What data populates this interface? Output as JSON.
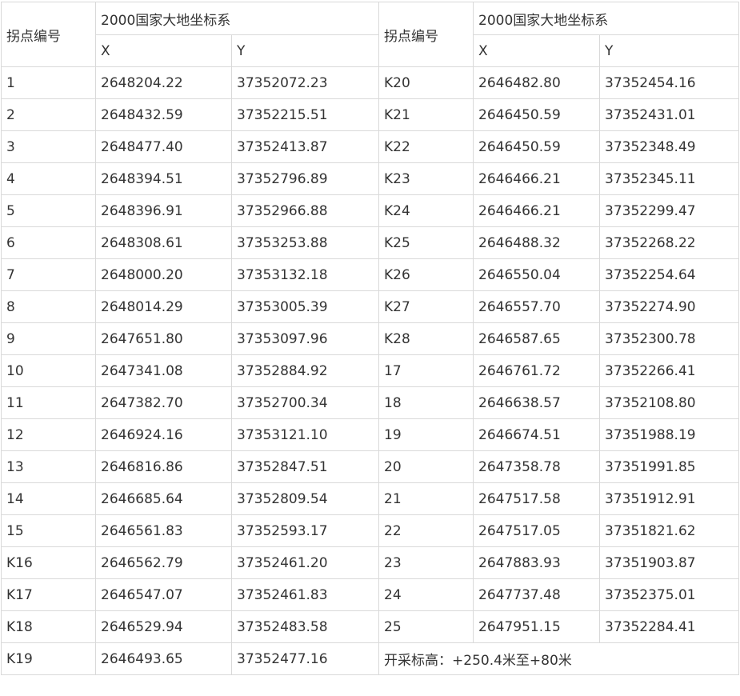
{
  "header": {
    "point_no_label": "拐点编号",
    "system_label": "2000国家大地坐标系",
    "x_label": "X",
    "y_label": "Y"
  },
  "rows": [
    {
      "left": {
        "id": "1",
        "x": "2648204.22",
        "y": "37352072.23"
      },
      "right": {
        "id": "K20",
        "x": "2646482.80",
        "y": "37352454.16"
      }
    },
    {
      "left": {
        "id": "2",
        "x": "2648432.59",
        "y": "37352215.51"
      },
      "right": {
        "id": "K21",
        "x": "2646450.59",
        "y": "37352431.01"
      }
    },
    {
      "left": {
        "id": "3",
        "x": "2648477.40",
        "y": "37352413.87"
      },
      "right": {
        "id": "K22",
        "x": "2646450.59",
        "y": "37352348.49"
      }
    },
    {
      "left": {
        "id": "4",
        "x": "2648394.51",
        "y": "37352796.89"
      },
      "right": {
        "id": "K23",
        "x": "2646466.21",
        "y": "37352345.11"
      }
    },
    {
      "left": {
        "id": "5",
        "x": "2648396.91",
        "y": "37352966.88"
      },
      "right": {
        "id": "K24",
        "x": "2646466.21",
        "y": "37352299.47"
      }
    },
    {
      "left": {
        "id": "6",
        "x": "2648308.61",
        "y": "37353253.88"
      },
      "right": {
        "id": "K25",
        "x": "2646488.32",
        "y": "37352268.22"
      }
    },
    {
      "left": {
        "id": "7",
        "x": "2648000.20",
        "y": "37353132.18"
      },
      "right": {
        "id": "K26",
        "x": "2646550.04",
        "y": "37352254.64"
      }
    },
    {
      "left": {
        "id": "8",
        "x": "2648014.29",
        "y": "37353005.39"
      },
      "right": {
        "id": "K27",
        "x": "2646557.70",
        "y": "37352274.90"
      }
    },
    {
      "left": {
        "id": "9",
        "x": "2647651.80",
        "y": "37353097.96"
      },
      "right": {
        "id": "K28",
        "x": "2646587.65",
        "y": "37352300.78"
      }
    },
    {
      "left": {
        "id": "10",
        "x": "2647341.08",
        "y": "37352884.92"
      },
      "right": {
        "id": "17",
        "x": "2646761.72",
        "y": "37352266.41"
      }
    },
    {
      "left": {
        "id": "11",
        "x": "2647382.70",
        "y": "37352700.34"
      },
      "right": {
        "id": "18",
        "x": "2646638.57",
        "y": "37352108.80"
      }
    },
    {
      "left": {
        "id": "12",
        "x": "2646924.16",
        "y": "37353121.10"
      },
      "right": {
        "id": "19",
        "x": "2646674.51",
        "y": "37351988.19"
      }
    },
    {
      "left": {
        "id": "13",
        "x": "2646816.86",
        "y": "37352847.51"
      },
      "right": {
        "id": "20",
        "x": "2647358.78",
        "y": "37351991.85"
      }
    },
    {
      "left": {
        "id": "14",
        "x": "2646685.64",
        "y": "37352809.54"
      },
      "right": {
        "id": "21",
        "x": "2647517.58",
        "y": "37351912.91"
      }
    },
    {
      "left": {
        "id": "15",
        "x": "2646561.83",
        "y": "37352593.17"
      },
      "right": {
        "id": "22",
        "x": "2647517.05",
        "y": "37351821.62"
      }
    },
    {
      "left": {
        "id": "K16",
        "x": "2646562.79",
        "y": "37352461.20"
      },
      "right": {
        "id": "23",
        "x": "2647883.93",
        "y": "37351903.87"
      }
    },
    {
      "left": {
        "id": "K17",
        "x": "2646547.07",
        "y": "37352461.83"
      },
      "right": {
        "id": "24",
        "x": "2647737.48",
        "y": "37352375.01"
      }
    },
    {
      "left": {
        "id": "K18",
        "x": "2646529.94",
        "y": "37352483.58"
      },
      "right": {
        "id": "25",
        "x": "2647951.15",
        "y": "37352284.41"
      }
    }
  ],
  "last_row": {
    "left": {
      "id": "K19",
      "x": "2646493.65",
      "y": "37352477.16"
    },
    "note": "开采标高：+250.4米至+80米"
  }
}
